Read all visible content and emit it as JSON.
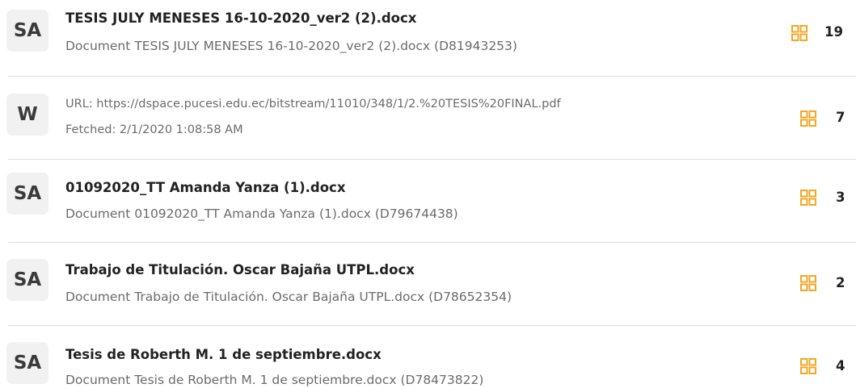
{
  "accent_color": "#f5a623",
  "sources": [
    {
      "badge": "SA",
      "title": "TESIS JULY MENESES 16-10-2020_ver2 (2).docx",
      "subtitle": "Document TESIS JULY MENESES 16-10-2020_ver2 (2).docx (D81943253)",
      "icon": "matches-grid-icon",
      "count": "19"
    },
    {
      "badge": "W",
      "line1": "URL: https://dspace.pucesi.edu.ec/bitstream/11010/348/1/2.%20TESIS%20FINAL.pdf",
      "line2": "Fetched: 2/1/2020 1:08:58 AM",
      "icon": "matches-grid-icon",
      "count": "7"
    },
    {
      "badge": "SA",
      "title": "01092020_TT Amanda Yanza (1).docx",
      "subtitle": "Document 01092020_TT Amanda Yanza (1).docx (D79674438)",
      "icon": "matches-grid-icon",
      "count": "3"
    },
    {
      "badge": "SA",
      "title": "Trabajo de Titulación. Oscar Bajaña UTPL.docx",
      "subtitle": "Document Trabajo de Titulación. Oscar Bajaña UTPL.docx (D78652354)",
      "icon": "matches-grid-icon",
      "count": "2"
    },
    {
      "badge": "SA",
      "title": "Tesis de Roberth M. 1 de septiembre.docx",
      "subtitle": "Document Tesis de Roberth M. 1 de septiembre.docx (D78473822)",
      "icon": "matches-grid-icon",
      "count": "4"
    }
  ]
}
